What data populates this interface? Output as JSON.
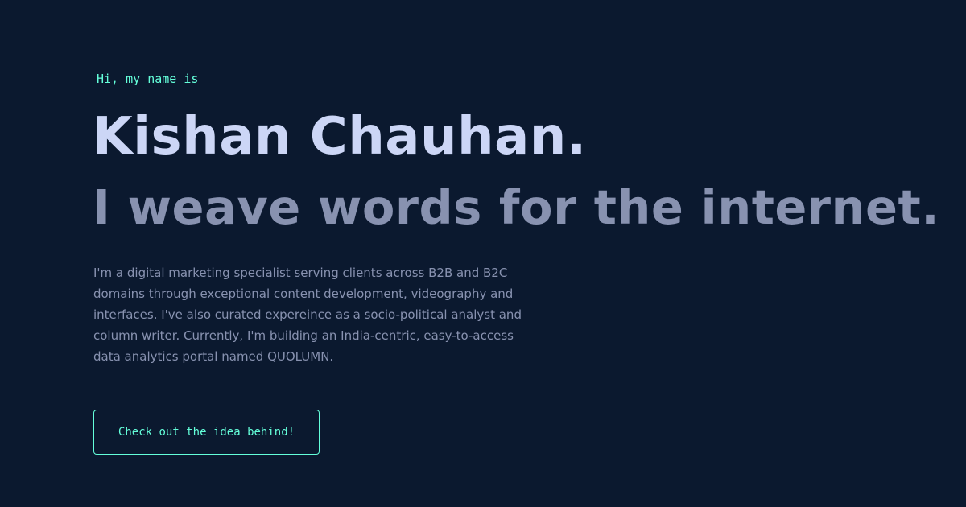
{
  "hero": {
    "intro": "Hi, my name is",
    "name": "Kishan Chauhan.",
    "tagline": "I weave words for the internet.",
    "bio": "I'm a digital marketing specialist serving clients across B2B and B2C domains through exceptional content development, videography and interfaces. I've also curated expereince as a socio-political analyst and column writer. Currently, I'm building an India-centric, easy-to-access data analytics portal named QUOLUMN.",
    "cta_label": "Check out the idea behind!"
  },
  "colors": {
    "background": "#0b192f",
    "accent": "#64ffda",
    "heading": "#ccd6f6",
    "muted": "#8892b0"
  }
}
